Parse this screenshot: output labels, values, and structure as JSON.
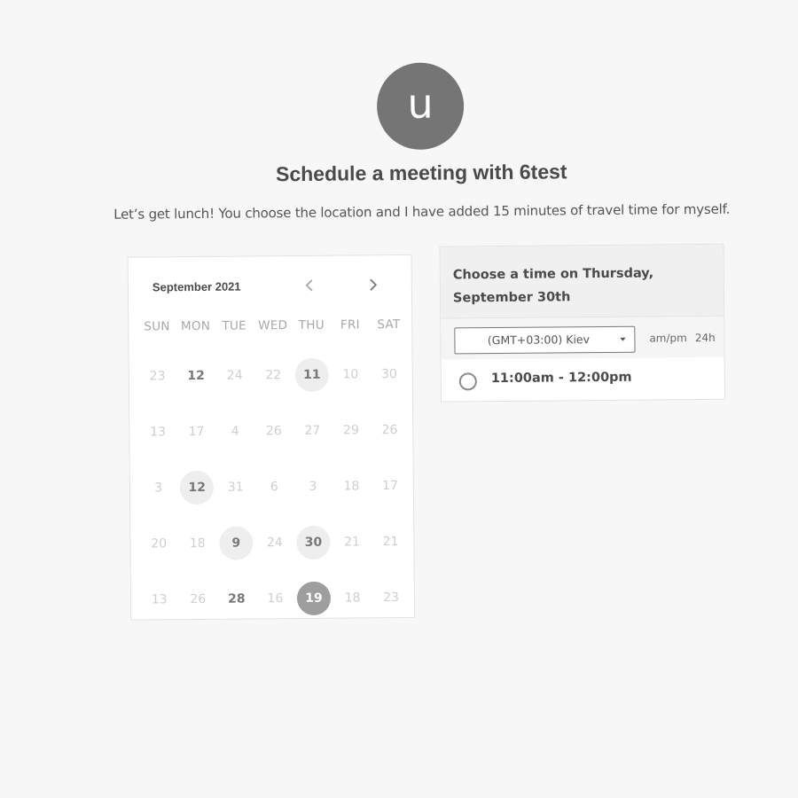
{
  "profile": {
    "avatar_letter": "u",
    "title": "Schedule a meeting with 6test",
    "description": "Let’s get lunch! You choose the location and I have added 15 minutes of travel time for myself."
  },
  "calendar": {
    "month_label": "September 2021",
    "prev_icon": "chevron-left-icon",
    "next_icon": "chevron-right-icon",
    "weekdays": [
      "SUN",
      "MON",
      "TUE",
      "WED",
      "THU",
      "FRI",
      "SAT"
    ],
    "weeks": [
      [
        {
          "label": "23",
          "state": "disabled"
        },
        {
          "label": "12",
          "state": "bold"
        },
        {
          "label": "24",
          "state": "disabled"
        },
        {
          "label": "22",
          "state": "disabled"
        },
        {
          "label": "11",
          "state": "available"
        },
        {
          "label": "10",
          "state": "disabled"
        },
        {
          "label": "30",
          "state": "disabled"
        }
      ],
      [
        {
          "label": "13",
          "state": "disabled"
        },
        {
          "label": "17",
          "state": "disabled"
        },
        {
          "label": "4",
          "state": "disabled"
        },
        {
          "label": "26",
          "state": "disabled"
        },
        {
          "label": "27",
          "state": "disabled"
        },
        {
          "label": "29",
          "state": "disabled"
        },
        {
          "label": "26",
          "state": "disabled"
        }
      ],
      [
        {
          "label": "3",
          "state": "disabled"
        },
        {
          "label": "12",
          "state": "available"
        },
        {
          "label": "31",
          "state": "disabled"
        },
        {
          "label": "6",
          "state": "disabled"
        },
        {
          "label": "3",
          "state": "disabled"
        },
        {
          "label": "18",
          "state": "disabled"
        },
        {
          "label": "17",
          "state": "disabled"
        }
      ],
      [
        {
          "label": "20",
          "state": "disabled"
        },
        {
          "label": "18",
          "state": "disabled"
        },
        {
          "label": "9",
          "state": "available"
        },
        {
          "label": "24",
          "state": "disabled"
        },
        {
          "label": "30",
          "state": "available"
        },
        {
          "label": "21",
          "state": "disabled"
        },
        {
          "label": "21",
          "state": "disabled"
        }
      ],
      [
        {
          "label": "13",
          "state": "disabled"
        },
        {
          "label": "26",
          "state": "disabled"
        },
        {
          "label": "28",
          "state": "bold"
        },
        {
          "label": "16",
          "state": "disabled"
        },
        {
          "label": "19",
          "state": "selected"
        },
        {
          "label": "18",
          "state": "disabled"
        },
        {
          "label": "23",
          "state": "disabled"
        }
      ]
    ]
  },
  "time_panel": {
    "heading": "Choose a time on Thursday, September 30th",
    "timezone": {
      "selected": "(GMT+03:00) Kiev"
    },
    "format_options": [
      "am/pm",
      "24h"
    ],
    "slots": [
      {
        "label": "11:00am - 12:00pm"
      }
    ]
  },
  "colors": {
    "page_bg": "#f7f7f7",
    "avatar_bg": "#757575",
    "selected_day": "#9e9e9e",
    "available_day": "#eeeeee"
  }
}
